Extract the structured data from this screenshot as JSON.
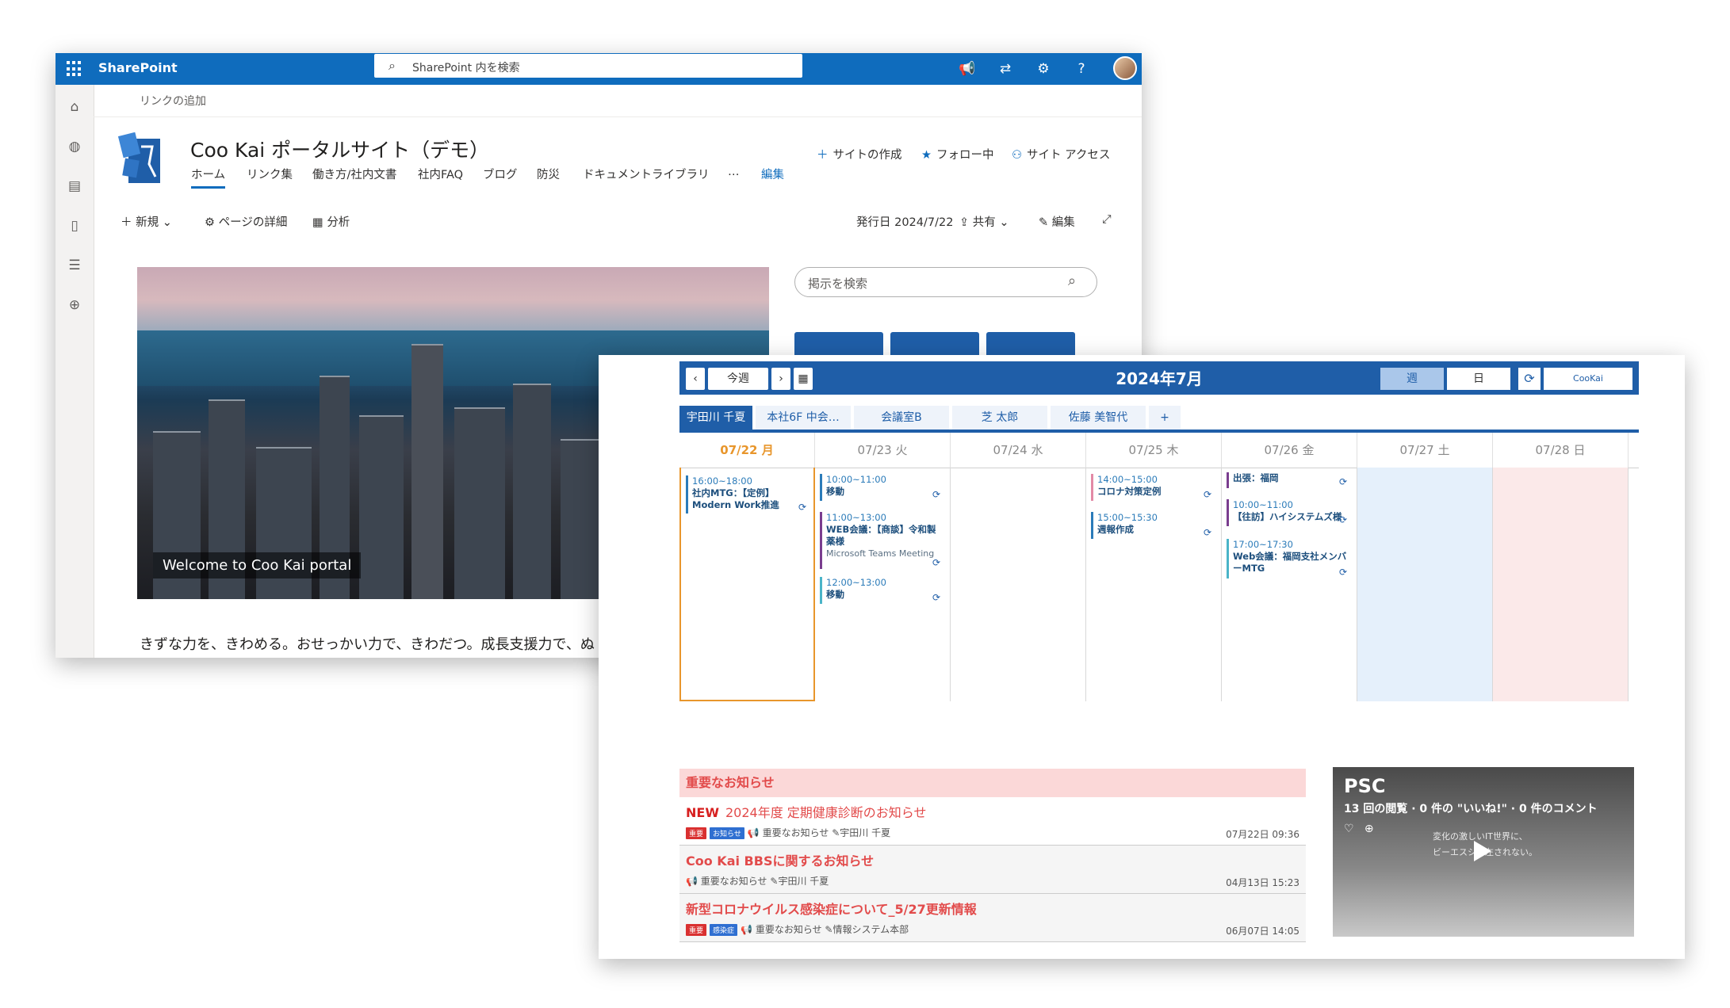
{
  "sharepoint": {
    "brand": "SharePoint",
    "search_placeholder": "SharePoint 内を検索",
    "add_link": "リンクの追加",
    "site_title": "Coo Kai ポータルサイト（デモ）",
    "nav": [
      "ホーム",
      "リンク集",
      "働き方/社内文書",
      "社内FAQ",
      "ブログ",
      "防災",
      "ドキュメントライブラリ",
      "…",
      "編集"
    ],
    "actions": {
      "create_site": "サイトの作成",
      "following": "フォロー中",
      "site_access": "サイト アクセス"
    },
    "commands": {
      "new": "新規",
      "page_details": "ページの詳細",
      "analytics": "分析",
      "published": "発行日 2024/7/22",
      "share": "共有",
      "edit": "編集"
    },
    "hero_caption": "Welcome to Coo Kai portal",
    "tagline": "きずな力を、きわめる。おせっかい力で、きわだつ。成長支援力で、ぬ",
    "bbs_search_placeholder": "掲示を検索",
    "accent_color": "#0f6cbd"
  },
  "calendar": {
    "today_button": "今週",
    "title": "2024年7月",
    "view_week": "週",
    "view_day": "日",
    "logo": "CooKai",
    "tabs": [
      "宇田川 千夏",
      "本社6F 中会…",
      "会議室B",
      "芝 太郎",
      "佐藤 美智代",
      "+"
    ],
    "days": [
      "07/22 月",
      "07/23 火",
      "07/24 水",
      "07/25 木",
      "07/26 金",
      "07/27 土",
      "07/28 日"
    ],
    "events": {
      "mon": [
        {
          "time": "16:00~18:00",
          "subject": "社内MTG：【定例】Modern Work推進"
        }
      ],
      "tue": [
        {
          "time": "10:00~11:00",
          "subject": "移動"
        },
        {
          "time": "11:00~13:00",
          "subject": "WEB会議：【商談】令和製薬様",
          "note": "Microsoft Teams Meeting"
        },
        {
          "time": "12:00~13:00",
          "subject": "移動"
        }
      ],
      "thu": [
        {
          "time": "14:00~15:00",
          "subject": "コロナ対策定例"
        },
        {
          "time": "15:00~15:30",
          "subject": "週報作成"
        }
      ],
      "fri": [
        {
          "time": "",
          "subject": "出張：福岡"
        },
        {
          "time": "10:00~11:00",
          "subject": "【往訪】ハイシステムズ様"
        },
        {
          "time": "17:00~17:30",
          "subject": "Web会議：福岡支社メンバーMTG"
        }
      ]
    }
  },
  "notices": {
    "header": "重要なお知らせ",
    "rows": [
      {
        "new": "NEW",
        "title": "2024年度 定期健康診断のお知らせ",
        "badges": [
          "重要",
          "お知らせ"
        ],
        "category": "重要なお知らせ",
        "author": "宇田川 千夏",
        "date": "07月22日 09:36"
      },
      {
        "new": "",
        "title": "Coo Kai BBSに関するお知らせ",
        "badges": [],
        "category": "重要なお知らせ",
        "author": "宇田川 千夏",
        "date": "04月13日 15:23"
      },
      {
        "new": "",
        "title": "新型コロナウイルス感染症について_5/27更新情報",
        "badges": [
          "重要",
          "感染症"
        ],
        "category": "重要なお知らせ",
        "author": "情報システム本部",
        "date": "06月07日 14:05"
      }
    ]
  },
  "video": {
    "title": "PSC",
    "meta": "13 回の閲覧 · 0 件の \"いいね!\" · 0 件のコメント",
    "text_line1": "変化の激しいIT世界に、",
    "text_line2": "ビーエスシ　左されない。"
  }
}
